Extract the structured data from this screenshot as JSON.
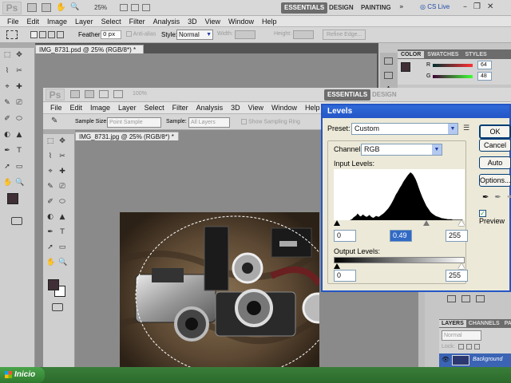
{
  "app": {
    "logo": "Ps",
    "zoom": "25%",
    "workspaces": [
      "ESSENTIALS",
      "DESIGN",
      "PAINTING"
    ],
    "cs_live": "CS Live"
  },
  "menu": [
    "File",
    "Edit",
    "Image",
    "Layer",
    "Select",
    "Filter",
    "Analysis",
    "3D",
    "View",
    "Window",
    "Help"
  ],
  "options_back": {
    "feather_label": "Feather:",
    "feather_value": "0 px",
    "antialias": "Anti-alias",
    "style_label": "Style:",
    "style_value": "Normal",
    "width_label": "Width:",
    "height_label": "Height:",
    "refine_edge": "Refine Edge..."
  },
  "options_front": {
    "sample_size_label": "Sample Size:",
    "sample_size_value": "Point Sample",
    "sample_label": "Sample:",
    "sample_value": "All Layers",
    "show_ring": "Show Sampling Ring"
  },
  "doc_tabs": {
    "back": "IMG_8731.psd @ 25% (RGB/8*) *",
    "front": "IMG_8731.jpg @ 25% (RGB/8*) *",
    "close": "×"
  },
  "front_app": {
    "zoom": "100%",
    "workspaces": [
      "ESSENTIALS",
      "DESIGN"
    ],
    "cs_live": "CS Live"
  },
  "color_panel": {
    "tabs": [
      "COLOR",
      "SWATCHES",
      "STYLES"
    ],
    "r_label": "R",
    "r_value": "64",
    "g_label": "G",
    "g_value": "48"
  },
  "layers_panel": {
    "tabs": [
      "LAYERS",
      "CHANNELS",
      "PA"
    ],
    "blend_mode": "Normal",
    "lock_label": "Lock:",
    "layer_name": "Background"
  },
  "levels": {
    "title": "Levels",
    "preset_label": "Preset:",
    "preset_value": "Custom",
    "channel_label": "Channel:",
    "channel_value": "RGB",
    "input_levels_label": "Input Levels:",
    "input_black": "0",
    "input_gamma": "0.49",
    "input_white": "255",
    "output_levels_label": "Output Levels:",
    "output_black": "0",
    "output_white": "255",
    "ok": "OK",
    "cancel": "Cancel",
    "auto": "Auto",
    "options": "Options...",
    "preview_label": "Preview",
    "preview_checked": true
  },
  "histogram": [
    0,
    0,
    0,
    0,
    0,
    0,
    0,
    0,
    0,
    0,
    0,
    0,
    0,
    1,
    3,
    6,
    8,
    10,
    14,
    11,
    8,
    9,
    12,
    10,
    8,
    7,
    9,
    11,
    8,
    6,
    5,
    7,
    9,
    8,
    7,
    9,
    11,
    13,
    15,
    18,
    21,
    24,
    28,
    32,
    37,
    42,
    48,
    54,
    58,
    63,
    68,
    72,
    77,
    82,
    86,
    90,
    94,
    97,
    100,
    98,
    95,
    90,
    85,
    78,
    70,
    62,
    55,
    48,
    42,
    36,
    30,
    26,
    22,
    18,
    15,
    13,
    11,
    9,
    8,
    7,
    6,
    5,
    4,
    4,
    3,
    3,
    2,
    2,
    2,
    2,
    1,
    1,
    1,
    1,
    1,
    1,
    1,
    1,
    0,
    0
  ],
  "taskbar": {
    "start": "Inicio"
  },
  "colors": {
    "foreground": "#402f36",
    "background": "#ffffff",
    "dialog_blue": "#2456c6",
    "taskbar_green": "#2f7a2f"
  }
}
